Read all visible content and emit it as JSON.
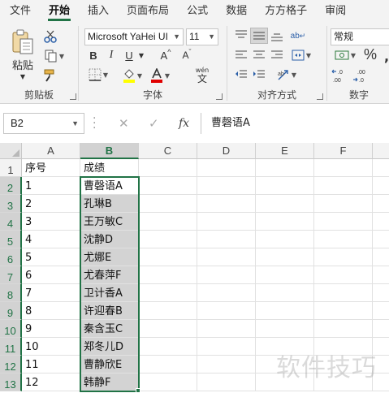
{
  "tabs": [
    "文件",
    "开始",
    "插入",
    "页面布局",
    "公式",
    "数据",
    "方方格子",
    "审阅"
  ],
  "active_tab": "开始",
  "clipboard": {
    "paste_label": "粘贴",
    "group_label": "剪贴板"
  },
  "font": {
    "name": "Microsoft YaHei UI",
    "size": "11",
    "bold": "B",
    "italic": "I",
    "underline": "U",
    "grow": "A",
    "shrink": "A",
    "phonetic": "wén",
    "group_label": "字体",
    "highlight_color": "#ffff00",
    "font_color": "#e00000"
  },
  "alignment": {
    "wrap_glyph": "ab",
    "group_label": "对齐方式"
  },
  "number": {
    "format": "常规",
    "percent": "%",
    "group_label": "数字"
  },
  "name_box": "B2",
  "formula_bar": {
    "fx": "fx",
    "content": "曹磬语A"
  },
  "columns": [
    "A",
    "B",
    "C",
    "D",
    "E",
    "F"
  ],
  "selected_column": "B",
  "rows": [
    {
      "num": "1",
      "a": "序号",
      "b": "成绩"
    },
    {
      "num": "2",
      "a": "1",
      "b": "曹磬语A"
    },
    {
      "num": "3",
      "a": "2",
      "b": "孔琳B"
    },
    {
      "num": "4",
      "a": "3",
      "b": "王万敏C"
    },
    {
      "num": "5",
      "a": "4",
      "b": "沈静D"
    },
    {
      "num": "6",
      "a": "5",
      "b": "尤娜E"
    },
    {
      "num": "7",
      "a": "6",
      "b": "尤春萍F"
    },
    {
      "num": "8",
      "a": "7",
      "b": "卫计香A"
    },
    {
      "num": "9",
      "a": "8",
      "b": "许迎春B"
    },
    {
      "num": "10",
      "a": "9",
      "b": "秦含玉C"
    },
    {
      "num": "11",
      "a": "10",
      "b": "郑冬儿D"
    },
    {
      "num": "12",
      "a": "11",
      "b": "曹静欣E"
    },
    {
      "num": "13",
      "a": "12",
      "b": "韩静F"
    }
  ],
  "watermark": "软件技巧",
  "accent_color": "#217346"
}
